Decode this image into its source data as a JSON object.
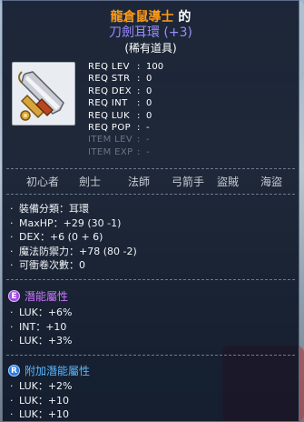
{
  "item": {
    "name_orange": "龍倉鼠導士",
    "name_white": " 的",
    "name_line2": "刀劍耳環 (+3)",
    "rarity": "(稀有道具)",
    "icon": "sword-earring-icon"
  },
  "requirements": [
    {
      "key": "REQ LEV",
      "value": "100",
      "dim": false
    },
    {
      "key": "REQ STR",
      "value": "0",
      "dim": false
    },
    {
      "key": "REQ DEX",
      "value": "0",
      "dim": false
    },
    {
      "key": "REQ INT",
      "value": "0",
      "dim": false
    },
    {
      "key": "REQ LUK",
      "value": "0",
      "dim": false
    },
    {
      "key": "REQ POP",
      "value": "-",
      "dim": false
    },
    {
      "key": "ITEM LEV",
      "value": "-",
      "dim": true
    },
    {
      "key": "ITEM EXP",
      "value": "-",
      "dim": true
    }
  ],
  "jobs": [
    "初心者",
    "劍士",
    "法師",
    "弓箭手",
    "盜賊",
    "海盜"
  ],
  "stats": [
    "裝備分類：耳環",
    "MaxHP：+29 (30 -1)",
    "DEX：+6 (0 + 6)",
    "魔法防禦力：+78 (80 -2)",
    "可衝卷次數：0"
  ],
  "potential": {
    "badge": "E",
    "title": "潛能屬性",
    "lines": [
      "LUK：+6%",
      "INT：+10",
      "LUK：+3%"
    ]
  },
  "bonus_potential": {
    "badge": "R",
    "title": "附加潛能屬性",
    "lines": [
      "LUK：+2%",
      "LUK：+10",
      "LUK：+10"
    ]
  },
  "colors": {
    "name_orange": "#ff9a14",
    "name_purple": "#9b8cff",
    "potential_purple": "#cc76ff",
    "bonus_blue": "#58b7ff"
  }
}
